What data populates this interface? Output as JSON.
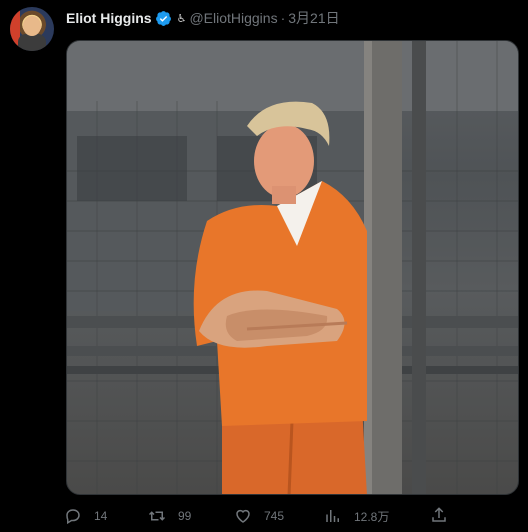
{
  "tweet": {
    "author_name": "Eliot Higgins",
    "handle": "@EliotHiggins",
    "separator": "·",
    "date": "3月21日",
    "name_emoji": "♿"
  },
  "actions": {
    "reply_count": "14",
    "retweet_count": "99",
    "like_count": "745",
    "views_count": "12.8万"
  },
  "colors": {
    "background": "#000000",
    "muted_text": "#71767b",
    "verified_badge": "#1d9bf0",
    "jumpsuit_orange": "#e8762a"
  }
}
